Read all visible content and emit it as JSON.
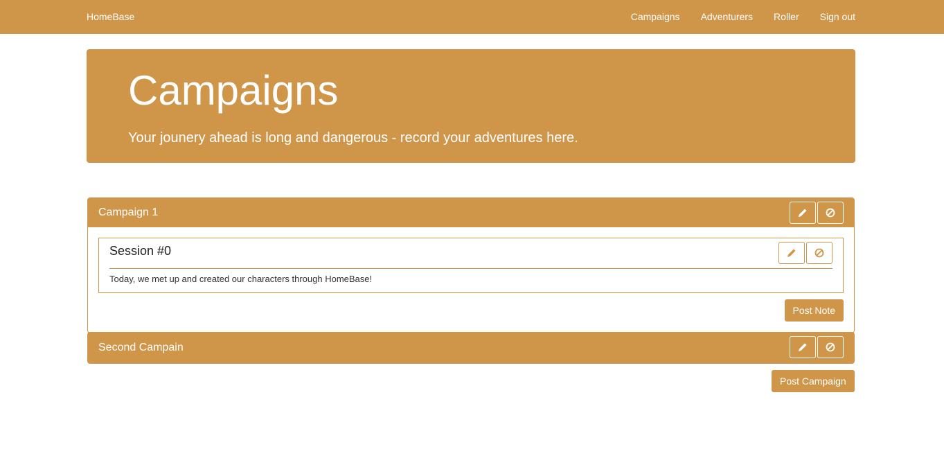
{
  "navbar": {
    "brand": "HomeBase",
    "links": [
      "Campaigns",
      "Adventurers",
      "Roller",
      "Sign out"
    ]
  },
  "jumbotron": {
    "title": "Campaigns",
    "subtitle": "Your jounery ahead is long and dangerous - record your adventures here."
  },
  "campaigns": [
    {
      "title": "Campaign 1",
      "sessions": [
        {
          "title": "Session #0",
          "text": "Today, we met up and created our characters through HomeBase!"
        }
      ],
      "post_note_label": "Post Note"
    },
    {
      "title": "Second Campain"
    }
  ],
  "post_campaign_label": "Post Campaign",
  "colors": {
    "accent": "#cf9549",
    "text_on_accent": "#ffffff"
  },
  "icons": {
    "edit": "pencil-icon",
    "delete": "ban-icon"
  }
}
